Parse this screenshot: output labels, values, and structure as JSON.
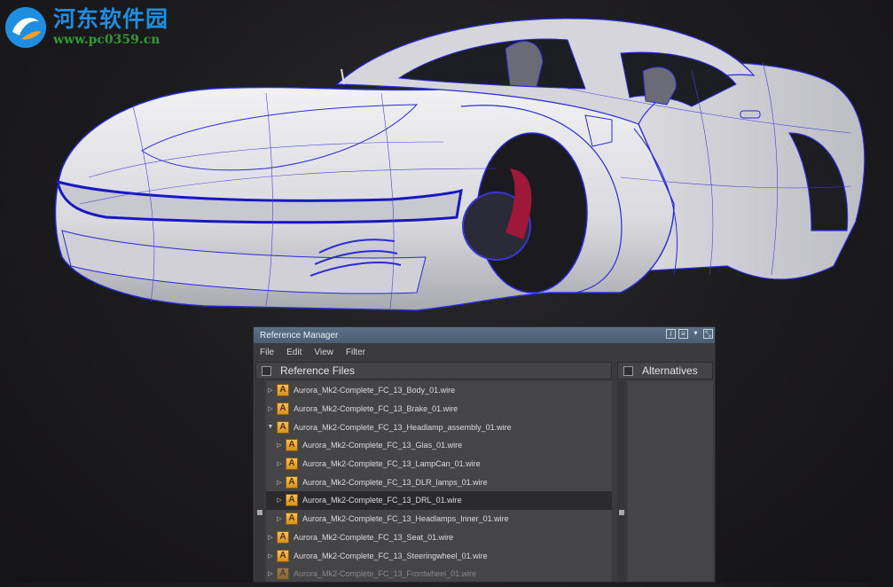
{
  "watermark": {
    "title": "河东软件园",
    "url": "www.pc0359.cn"
  },
  "viewport": {
    "subject": "car-wireframe-model"
  },
  "reference_manager": {
    "title": "Reference Manager",
    "menu": [
      "File",
      "Edit",
      "View",
      "Filter"
    ],
    "panes": {
      "reference_files": "Reference Files",
      "alternatives": "Alternatives"
    },
    "selected_index": 7,
    "files": [
      {
        "name": "Aurora_Mk2-Complete_FC_13_Body_01.wire",
        "depth": 0,
        "expander": "collapsed"
      },
      {
        "name": "Aurora_Mk2-Complete_FC_13_Brake_01.wire",
        "depth": 0,
        "expander": "collapsed"
      },
      {
        "name": "Aurora_Mk2-Complete_FC_13_Headlamp_assembly_01.wire",
        "depth": 0,
        "expander": "expanded"
      },
      {
        "name": "Aurora_Mk2-Complete_FC_13_Glas_01.wire",
        "depth": 1,
        "expander": "collapsed"
      },
      {
        "name": "Aurora_Mk2-Complete_FC_13_LampCan_01.wire",
        "depth": 1,
        "expander": "collapsed"
      },
      {
        "name": "Aurora_Mk2-Complete_FC_13_DLR_lamps_01.wire",
        "depth": 1,
        "expander": "collapsed"
      },
      {
        "name": "Aurora_Mk2-Complete_FC_13_DRL_01.wire",
        "depth": 1,
        "expander": "collapsed"
      },
      {
        "name": "Aurora_Mk2-Complete_FC_13_Headlamps_Inner_01.wire",
        "depth": 1,
        "expander": "collapsed"
      },
      {
        "name": "Aurora_Mk2-Complete_FC_13_Seat_01.wire",
        "depth": 0,
        "expander": "collapsed"
      },
      {
        "name": "Aurora_Mk2-Complete_FC_13_Steeringwheel_01.wire",
        "depth": 0,
        "expander": "collapsed"
      },
      {
        "name": "Aurora_Mk2-Complete_FC_13_Frontwheel_01.wire",
        "depth": 0,
        "expander": "collapsed",
        "faded": true
      }
    ]
  },
  "colors": {
    "accent_wire": "#2a2ad8",
    "titlebar": "#56697e",
    "icon_orange": "#e6a63a"
  }
}
